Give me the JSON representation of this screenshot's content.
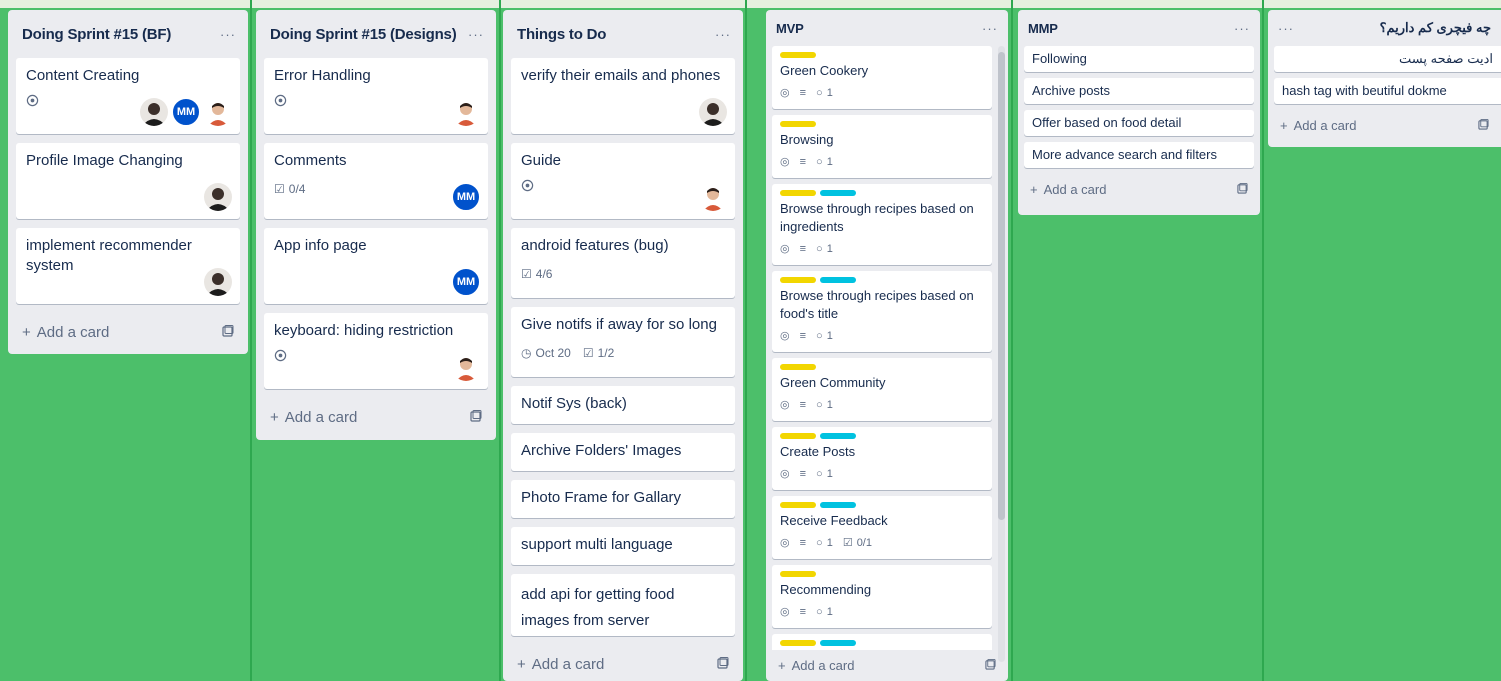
{
  "lists": [
    {
      "title": "Doing Sprint #15 (BF)",
      "cards": [
        {
          "title": "Content Creating",
          "badge": "eye",
          "avatars": [
            "dark",
            "MM",
            "light"
          ]
        },
        {
          "title": "Profile Image Changing",
          "avatars": [
            "dark"
          ]
        },
        {
          "title": "implement recommender system",
          "avatars": [
            "dark"
          ]
        }
      ],
      "add": "Add a card"
    },
    {
      "title": "Doing Sprint #15 (Designs)",
      "cards": [
        {
          "title": "Error Handling",
          "badge": "eye",
          "avatars": [
            "light"
          ]
        },
        {
          "title": "Comments",
          "checklist": "0/4",
          "avatars": [
            "MM"
          ]
        },
        {
          "title": "App info page",
          "avatars": [
            "MM"
          ]
        },
        {
          "title": "keyboard: hiding restriction",
          "badge": "eye",
          "avatars": [
            "light"
          ]
        }
      ],
      "add": "Add a card"
    },
    {
      "title": "Things to Do",
      "cards": [
        {
          "title": "verify their emails and phones",
          "avatars": [
            "dark"
          ]
        },
        {
          "title": "Guide",
          "badge": "eye",
          "avatars": [
            "light"
          ]
        },
        {
          "title": "android features (bug)",
          "checklist": "4/6"
        },
        {
          "title": "Give notifs if away for so long",
          "due": "Oct 20",
          "checklist": "1/2"
        },
        {
          "title": "Notif Sys (back)"
        },
        {
          "title": "Archive Folders' Images"
        },
        {
          "title": "Photo Frame for Gallary"
        },
        {
          "title": "support multi language"
        },
        {
          "title": "add api for getting food images from server"
        }
      ],
      "add": "Add a card"
    },
    {
      "title": "MVP",
      "cards": [
        {
          "title": "Green Cookery",
          "labels": [
            "#f2d600"
          ],
          "comments": "1"
        },
        {
          "title": "Browsing",
          "labels": [
            "#f2d600"
          ],
          "comments": "1"
        },
        {
          "title": "Browse through recipes based on ingredients",
          "labels": [
            "#f2d600",
            "#00c2e0"
          ],
          "comments": "1"
        },
        {
          "title": "Browse through recipes based on food's title",
          "labels": [
            "#f2d600",
            "#00c2e0"
          ],
          "comments": "1"
        },
        {
          "title": "Green Community",
          "labels": [
            "#f2d600"
          ],
          "comments": "1"
        },
        {
          "title": "Create Posts",
          "labels": [
            "#f2d600",
            "#00c2e0"
          ],
          "comments": "1"
        },
        {
          "title": "Receive Feedback",
          "labels": [
            "#f2d600",
            "#00c2e0"
          ],
          "comments": "1",
          "checklist": "0/1"
        },
        {
          "title": "Recommending",
          "labels": [
            "#f2d600"
          ],
          "comments": "1"
        }
      ],
      "add": "Add a card"
    },
    {
      "title": "MMP",
      "cards": [
        {
          "title": "Following"
        },
        {
          "title": "Archive posts"
        },
        {
          "title": "Offer based on food detail"
        },
        {
          "title": "More advance search and filters"
        }
      ],
      "add": "Add a card"
    },
    {
      "title": "چه فیچری کم داریم؟",
      "cards": [
        {
          "title": "ادیت صفحه پست"
        },
        {
          "title": "hash tag with beutiful dokme"
        }
      ],
      "add": "Add a card"
    }
  ],
  "icons": {
    "more": "ellipsis-icon",
    "plus": "plus-icon",
    "template": "card-template-icon",
    "eye": "watch-eye-icon",
    "checklist": "checklist-icon",
    "clock": "clock-icon",
    "comment": "comment-icon",
    "description": "description-icon"
  }
}
